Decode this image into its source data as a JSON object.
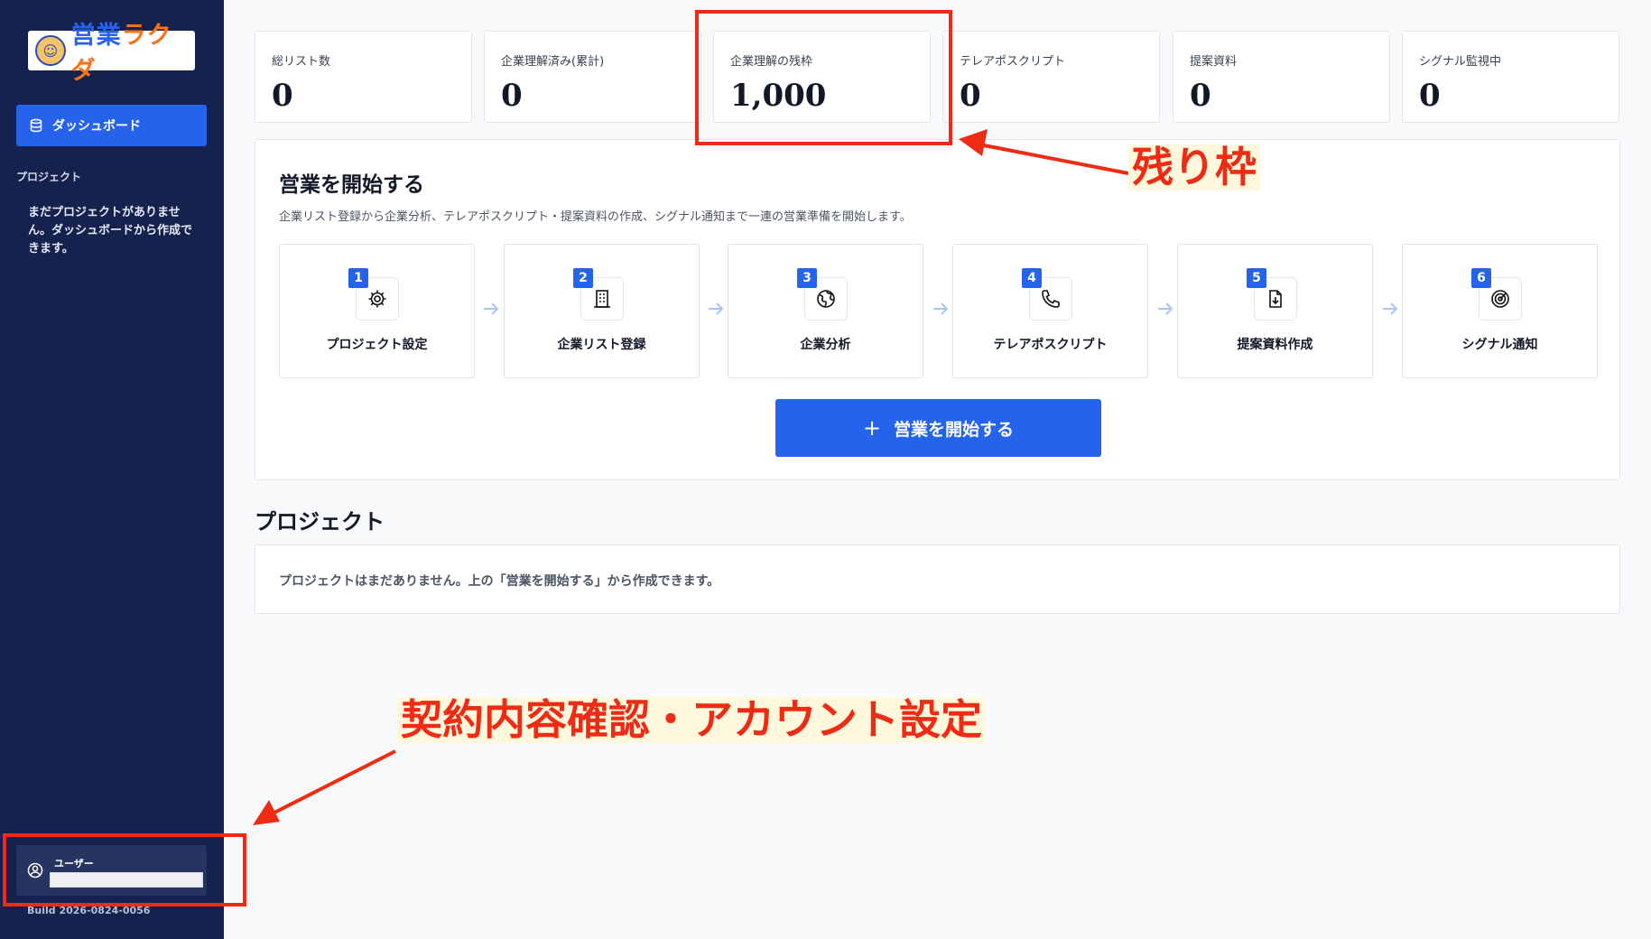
{
  "sidebar": {
    "logo_text_a": "営業",
    "logo_text_b": "ラクダ",
    "nav_dashboard": "ダッシュボード",
    "section_label": "プロジェクト",
    "empty_text": "まだプロジェクトがありません。ダッシュボードから作成できます。",
    "user_label": "ユーザー",
    "build": "Build 2026-0824-0056"
  },
  "stats": [
    {
      "label": "総リスト数",
      "value": "0"
    },
    {
      "label": "企業理解済み(累計)",
      "value": "0"
    },
    {
      "label": "企業理解の残枠",
      "value": "1,000"
    },
    {
      "label": "テレアポスクリプト",
      "value": "0"
    },
    {
      "label": "提案資料",
      "value": "0"
    },
    {
      "label": "シグナル監視中",
      "value": "0"
    }
  ],
  "start": {
    "title": "営業を開始する",
    "description": "企業リスト登録から企業分析、テレアポスクリプト・提案資料の作成、シグナル通知まで一連の営業準備を開始します。",
    "button_label": "営業を開始する",
    "steps": [
      {
        "num": "1",
        "label": "プロジェクト設定",
        "icon": "gear-icon"
      },
      {
        "num": "2",
        "label": "企業リスト登録",
        "icon": "building-icon"
      },
      {
        "num": "3",
        "label": "企業分析",
        "icon": "globe-icon"
      },
      {
        "num": "4",
        "label": "テレアポスクリプト",
        "icon": "phone-icon"
      },
      {
        "num": "5",
        "label": "提案資料作成",
        "icon": "document-download-icon"
      },
      {
        "num": "6",
        "label": "シグナル通知",
        "icon": "radar-icon"
      }
    ]
  },
  "projects": {
    "title": "プロジェクト",
    "empty_text": "プロジェクトはまだありません。上の「営業を開始する」から作成できます。"
  },
  "annotations": {
    "remaining": "残り枠",
    "account": "契約内容確認・アカウント設定"
  },
  "colors": {
    "sidebar_bg": "#15224e",
    "accent": "#2563eb",
    "annotation": "#ee2b15"
  }
}
